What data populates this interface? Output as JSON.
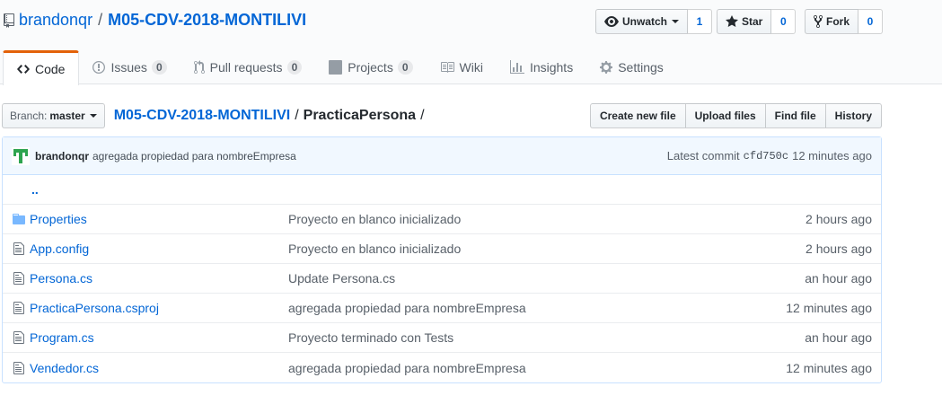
{
  "repo": {
    "owner": "brandonqr",
    "separator": "/",
    "name": "M05-CDV-2018-MONTILIVI"
  },
  "actions": {
    "watch": {
      "label": "Unwatch",
      "count": "1"
    },
    "star": {
      "label": "Star",
      "count": "0"
    },
    "fork": {
      "label": "Fork",
      "count": "0"
    }
  },
  "tabs": [
    {
      "label": "Code",
      "icon": "code-icon",
      "selected": true
    },
    {
      "label": "Issues",
      "icon": "issue-icon",
      "count": "0"
    },
    {
      "label": "Pull requests",
      "icon": "pull-request-icon",
      "count": "0"
    },
    {
      "label": "Projects",
      "icon": "project-icon",
      "count": "0"
    },
    {
      "label": "Wiki",
      "icon": "book-icon"
    },
    {
      "label": "Insights",
      "icon": "graph-icon"
    },
    {
      "label": "Settings",
      "icon": "gear-icon"
    }
  ],
  "filenav": {
    "branch_prefix": "Branch:",
    "branch": "master",
    "root": "M05-CDV-2018-MONTILIVI",
    "sep": "/",
    "folder": "PracticaPersona",
    "trailing_sep": "/",
    "buttons": {
      "create": "Create new file",
      "upload": "Upload files",
      "find": "Find file",
      "history": "History"
    }
  },
  "commit": {
    "author": "brandonqr",
    "message": "agregada propiedad para nombreEmpresa",
    "latest_label": "Latest commit",
    "sha": "cfd750c",
    "age": "12 minutes ago"
  },
  "up_link": "..",
  "files": [
    {
      "name": "Properties",
      "type": "directory",
      "icon": "folder-icon",
      "message": "Proyecto en blanco inicializado",
      "age": "2 hours ago"
    },
    {
      "name": "App.config",
      "type": "file",
      "icon": "file-icon",
      "message": "Proyecto en blanco inicializado",
      "age": "2 hours ago"
    },
    {
      "name": "Persona.cs",
      "type": "file",
      "icon": "file-icon",
      "message": "Update Persona.cs",
      "age": "an hour ago"
    },
    {
      "name": "PracticaPersona.csproj",
      "type": "file",
      "icon": "file-icon",
      "message": "agregada propiedad para nombreEmpresa",
      "age": "12 minutes ago"
    },
    {
      "name": "Program.cs",
      "type": "file",
      "icon": "file-icon",
      "message": "Proyecto terminado con Tests",
      "age": "an hour ago"
    },
    {
      "name": "Vendedor.cs",
      "type": "file",
      "icon": "file-icon",
      "message": "agregada propiedad para nombreEmpresa",
      "age": "12 minutes ago"
    }
  ],
  "colors": {
    "link": "#0366d6",
    "selected_tab_accent": "#e36209",
    "folder": "#79b8ff",
    "commit_bg": "#f1f8ff",
    "avatar": "#2ea44f"
  }
}
